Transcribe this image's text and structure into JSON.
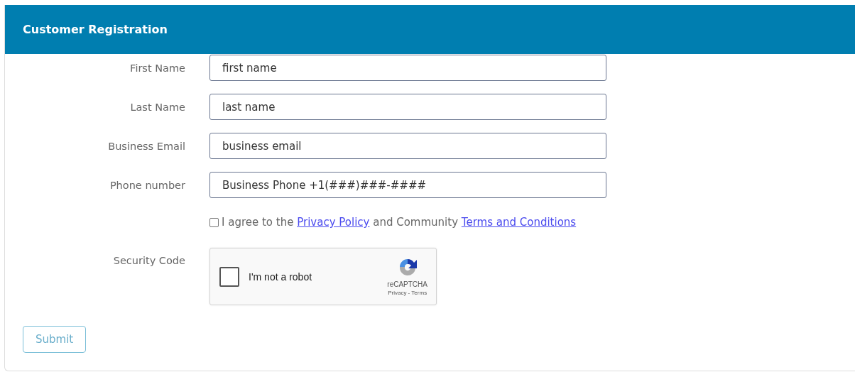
{
  "header": {
    "title": "Customer Registration"
  },
  "fields": [
    {
      "label": "First Name",
      "placeholder": "first name"
    },
    {
      "label": "Last Name",
      "placeholder": "last name"
    },
    {
      "label": "Business Email",
      "placeholder": "business email"
    },
    {
      "label": "Phone number",
      "placeholder": "Business Phone +1(###)###-####"
    }
  ],
  "agreement": {
    "checked": false,
    "parts": [
      {
        "kind": "text",
        "text": "I agree to the"
      },
      {
        "kind": "link",
        "text": "Privacy Policy"
      },
      {
        "kind": "text",
        "text": "and Community"
      },
      {
        "kind": "link",
        "text": "Terms and Conditions"
      }
    ]
  },
  "security": {
    "label": "Security Code",
    "captcha": {
      "checked": false,
      "label": "I'm not a robot",
      "brand": "reCAPTCHA",
      "links": [
        "Privacy - Terms"
      ]
    }
  },
  "submit": {
    "label": "Submit"
  }
}
